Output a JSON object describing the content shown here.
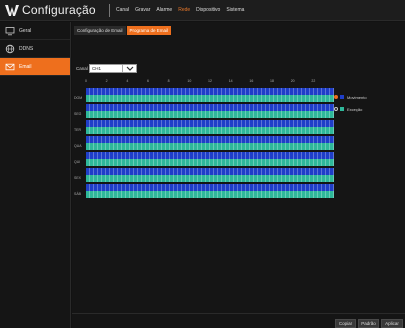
{
  "header": {
    "title": "Configuração",
    "nav": [
      "Canal",
      "Gravar",
      "Alarme",
      "Rede",
      "Dispositivo",
      "Sistema"
    ],
    "active_nav_index": 3
  },
  "sidebar": {
    "items": [
      {
        "label": "Geral",
        "icon": "monitor-icon",
        "active": false
      },
      {
        "label": "DDNS",
        "icon": "globe-icon",
        "active": false
      },
      {
        "label": "Email",
        "icon": "mail-icon",
        "active": true
      }
    ]
  },
  "subtabs": [
    {
      "label": "Configuração de Email",
      "active": false
    },
    {
      "label": "Programa de Email",
      "active": true
    }
  ],
  "channel": {
    "label": "Canal",
    "value": "CH1"
  },
  "schedule": {
    "hours": [
      "0",
      "2",
      "4",
      "6",
      "8",
      "10",
      "12",
      "14",
      "16",
      "18",
      "20",
      "22"
    ],
    "days": [
      "DOM",
      "SEG",
      "TER",
      "QUA",
      "QUI",
      "SEX",
      "SÁB"
    ],
    "top_band": "Movimento",
    "bottom_band": "Exceção"
  },
  "legend": [
    {
      "label": "Movimento",
      "color": "#1f3ec8",
      "selected": true
    },
    {
      "label": "Exceção",
      "color": "#2fb89a",
      "selected": false
    }
  ],
  "buttons": {
    "default": "Padrão",
    "copy": "Copiar",
    "apply": "Aplicar"
  },
  "colors": {
    "accent": "#ee6f1d",
    "motion": "#1f3ec8",
    "exception": "#2fb89a"
  }
}
